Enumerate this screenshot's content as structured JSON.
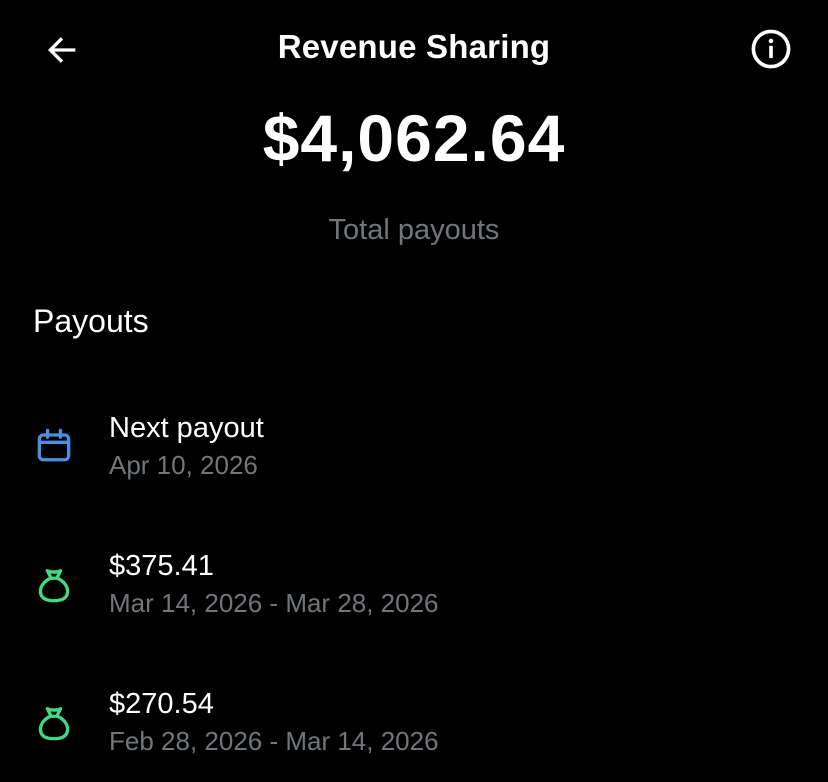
{
  "header": {
    "title": "Revenue Sharing",
    "back_icon": "arrow-left-icon",
    "info_icon": "info-circle-icon"
  },
  "summary": {
    "total_amount": "$4,062.64",
    "total_label": "Total payouts"
  },
  "payouts": {
    "heading": "Payouts",
    "items": [
      {
        "icon": "calendar-icon",
        "primary": "Next payout",
        "secondary": "Apr 10, 2026",
        "icon_color": "#4a90e2"
      },
      {
        "icon": "money-bag-icon",
        "primary": "$375.41",
        "secondary": "Mar 14, 2026 - Mar 28, 2026",
        "icon_color": "#3ddc84"
      },
      {
        "icon": "money-bag-icon",
        "primary": "$270.54",
        "secondary": "Feb 28, 2026 - Mar 14, 2026",
        "icon_color": "#3ddc84"
      }
    ]
  },
  "colors": {
    "background": "#000000",
    "text_primary": "#ffffff",
    "text_secondary": "#71767b",
    "calendar_accent": "#4a90e2",
    "money_accent": "#3ddc84"
  }
}
